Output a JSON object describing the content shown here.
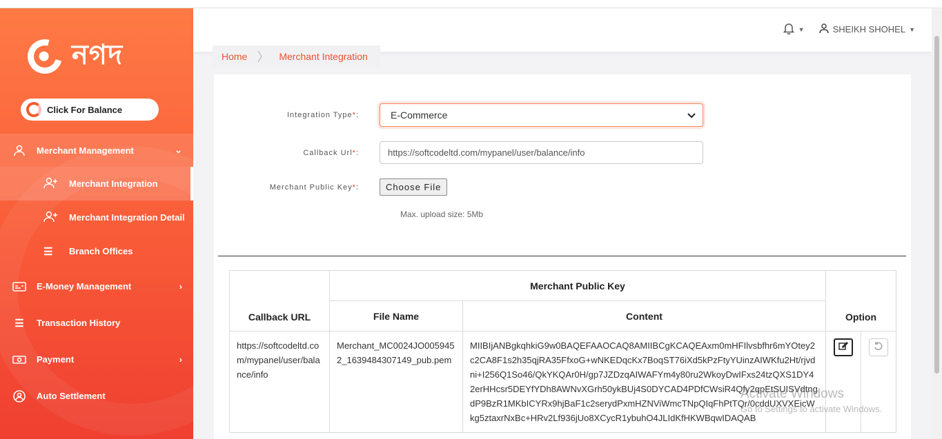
{
  "app": {
    "logo_text": "নগদ",
    "balance_button": "Click For Balance"
  },
  "sidebar": {
    "items": [
      {
        "label": "Merchant Management",
        "icon": "user-icon"
      },
      {
        "label": "E-Money Management",
        "icon": "card-icon"
      },
      {
        "label": "Transaction History",
        "icon": "list-icon"
      },
      {
        "label": "Payment",
        "icon": "money-icon"
      },
      {
        "label": "Auto Settlement",
        "icon": "user-circle-icon"
      }
    ],
    "sub_items": [
      {
        "label": "Merchant Integration",
        "icon": "user-plus-icon"
      },
      {
        "label": "Merchant Integration Detail",
        "icon": "user-plus-icon"
      },
      {
        "label": "Branch Offices",
        "icon": "list-icon"
      }
    ]
  },
  "header": {
    "user_name": "SHEIKH SHOHEL"
  },
  "breadcrumb": [
    "Home",
    "Merchant Integration"
  ],
  "form": {
    "integration_type_label": "Integration Type",
    "integration_type_value": "E-Commerce",
    "callback_url_label": "Callback Url",
    "callback_url_value": "https://softcodeltd.com/mypanel/user/balance/info",
    "public_key_label": "Merchant Public Key",
    "choose_file": "Choose File",
    "required_mark": "*",
    "label_suffix": ":",
    "upload_hint": "Max. upload size: 5Mb"
  },
  "table": {
    "headers": {
      "callback_url": "Callback URL",
      "public_key_group": "Merchant Public Key",
      "file_name": "File Name",
      "content": "Content",
      "option": "Option"
    },
    "rows": [
      {
        "callback_url": "https://softcodeltd.com/mypanel/user/balance/info",
        "file_name": "Merchant_MC0024JO0059452_1639484307149_pub.pem",
        "content": "MIIBIjANBgkqhkiG9w0BAQEFAAOCAQ8AMIIBCgKCAQEAxm0mHFIlvsbfhr6mYOtey2c2CA8F1s2h35qjRA35FfxoG+wNKEDqcKx7BoqST76iXd5kPzFtyYUinzAIWKfu2Ht/rjvdni+I256Q1So46/QkYKQAr0H/gp7JZDzqAIWAFYm4y80ru2WkoyDwIFxs24tzQXS1DY42erHHcsr5DEYfYDh8AWNvXGrh50ykBUj4S0DYCAD4PDfCWsiR4Qfy2qpEtSUISVdtngdP9BzR1MKbICYRx9hjBaF1c2serydPxmHZNViWmcTNpQIqFhPtTQr/0cddUXVXEicWkg5ztaxrNxBc+HRv2Lf936jUo8XCycR1ybuhO4JLIdKfHKWBqwIDAQAB"
      }
    ]
  },
  "watermark": {
    "line1": "Activate Windows",
    "line2": "Go to Settings to activate Windows."
  }
}
